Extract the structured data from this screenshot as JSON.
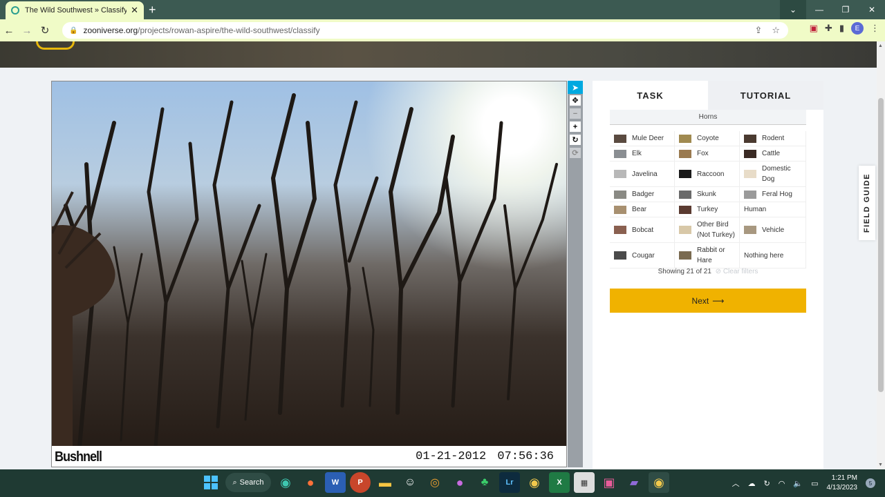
{
  "browser": {
    "tab_title": "The Wild Southwest » Classify —",
    "new_tab": "+",
    "url_host": "zooniverse.org",
    "url_path": "/projects/rowan-aspire/the-wild-southwest/classify",
    "profile_initial": "E"
  },
  "subject": {
    "brand": "Bushnell",
    "date": "01-21-2012",
    "time": "07:56:36"
  },
  "panel": {
    "tabs": [
      "TASK",
      "TUTORIAL"
    ],
    "filter_label": "Horns",
    "choices": [
      {
        "label": "Mule Deer",
        "thumb": "#5a4a40"
      },
      {
        "label": "Coyote",
        "thumb": "#a08a50"
      },
      {
        "label": "Rodent",
        "thumb": "#4a3a30"
      },
      {
        "label": "Elk",
        "thumb": "#8a8e92"
      },
      {
        "label": "Fox",
        "thumb": "#9a7a50"
      },
      {
        "label": "Cattle",
        "thumb": "#3a2a24"
      },
      {
        "label": "Javelina",
        "thumb": "#b8b8b8"
      },
      {
        "label": "Raccoon",
        "thumb": "#1a1a1a"
      },
      {
        "label": "Domestic Dog",
        "thumb": "#e8dcc8"
      },
      {
        "label": "Badger",
        "thumb": "#8a8a84"
      },
      {
        "label": "Skunk",
        "thumb": "#6a6a6a"
      },
      {
        "label": "Feral Hog",
        "thumb": "#9a9a9a"
      },
      {
        "label": "Bear",
        "thumb": "#a89070"
      },
      {
        "label": "Turkey",
        "thumb": "#5a3a30"
      },
      {
        "label": "Human",
        "thumb": ""
      },
      {
        "label": "Bobcat",
        "thumb": "#8a6050"
      },
      {
        "label": "Other Bird (Not Turkey)",
        "thumb": "#d8c8a8"
      },
      {
        "label": "Vehicle",
        "thumb": "#a89880"
      },
      {
        "label": "Cougar",
        "thumb": "#4a4a4a"
      },
      {
        "label": "Rabbit or Hare",
        "thumb": "#7a6a50"
      },
      {
        "label": "Nothing here",
        "thumb": ""
      }
    ],
    "showing": "Showing 21 of 21",
    "clear_filters": "Clear filters",
    "next_label": "Next"
  },
  "field_guide": "FIELD GUIDE",
  "taskbar": {
    "search_label": "Search",
    "time": "1:21 PM",
    "date": "4/13/2023",
    "notif_count": "5"
  },
  "colors": {
    "accent": "#f0b200",
    "tool_active": "#00a9e0",
    "tab_bg": "#f0fbc7"
  }
}
